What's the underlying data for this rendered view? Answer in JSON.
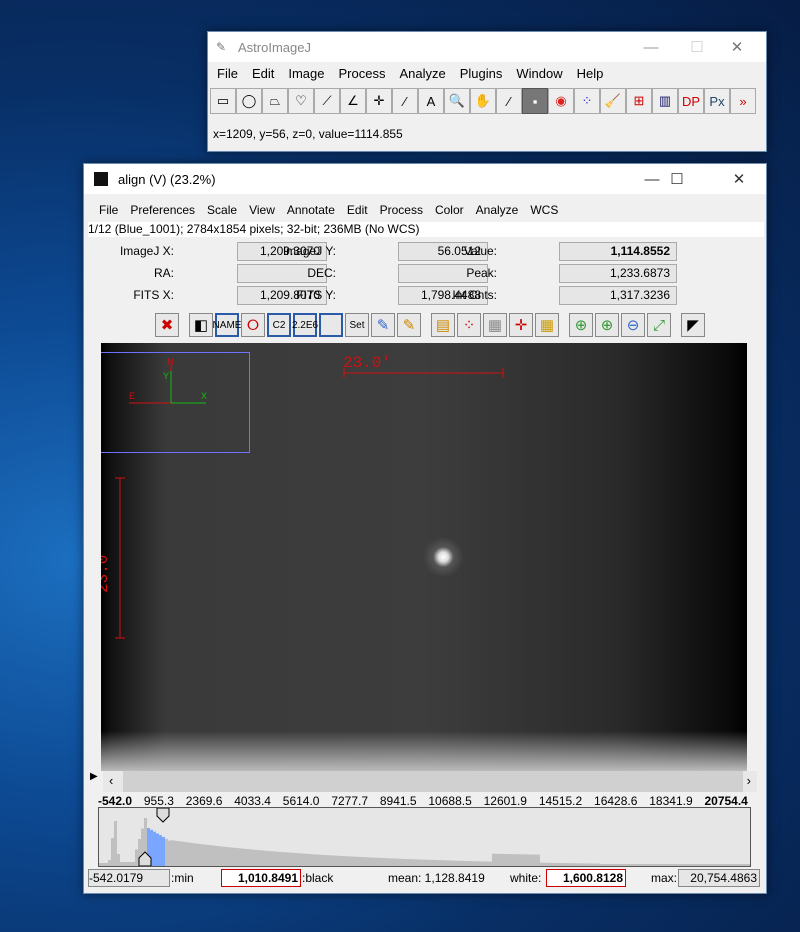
{
  "main_window": {
    "title": "AstroImageJ",
    "controls": {
      "minimize": "—",
      "maximize": "☐",
      "close": "✕"
    },
    "menu": [
      "File",
      "Edit",
      "Image",
      "Process",
      "Analyze",
      "Plugins",
      "Window",
      "Help"
    ],
    "tools": [
      {
        "icon": "rectangle-icon",
        "glyph": "▭"
      },
      {
        "icon": "oval-icon",
        "glyph": "◯"
      },
      {
        "icon": "polygon-icon",
        "glyph": "⏢"
      },
      {
        "icon": "freehand-icon",
        "glyph": "♡"
      },
      {
        "icon": "line-icon",
        "glyph": "⟋"
      },
      {
        "icon": "angle-icon",
        "glyph": "∠"
      },
      {
        "icon": "point-icon",
        "glyph": "✛"
      },
      {
        "icon": "wand-icon",
        "glyph": "⁄"
      },
      {
        "icon": "text-icon",
        "glyph": "A"
      },
      {
        "icon": "magnifier-icon",
        "glyph": "🔍"
      },
      {
        "icon": "hand-icon",
        "glyph": "✋"
      },
      {
        "icon": "dropper-icon",
        "glyph": "⁄"
      },
      {
        "icon": "astro-image-icon",
        "glyph": "▪"
      },
      {
        "icon": "aperture-icon",
        "glyph": "◉"
      },
      {
        "icon": "multi-aperture-icon",
        "glyph": "⁘"
      },
      {
        "icon": "broom-icon",
        "glyph": "🧹"
      },
      {
        "icon": "plot-icon",
        "glyph": "⊞"
      },
      {
        "icon": "table-icon",
        "glyph": "▥"
      },
      {
        "icon": "dp-icon",
        "glyph": "DP"
      },
      {
        "icon": "fits-header-icon",
        "glyph": "Px"
      },
      {
        "icon": "more-icon",
        "glyph": "»"
      }
    ],
    "status": "x=1209, y=56, z=0, value=1114.855"
  },
  "image_window": {
    "title": "align (V) (23.2%)",
    "menu": [
      "File",
      "Preferences",
      "Scale",
      "View",
      "Annotate",
      "Edit",
      "Process",
      "Color",
      "Analyze",
      "WCS"
    ],
    "info": "1/12 (Blue_1001); 2784x1854 pixels; 32-bit; 236MB (No WCS)",
    "fields": {
      "imagej_x": {
        "label": "ImageJ X:",
        "value": "1,209.3070"
      },
      "imagej_y": {
        "label": "ImageJ Y:",
        "value": "56.0512"
      },
      "value": {
        "label": "Value:",
        "value": "1,114.8552"
      },
      "ra": {
        "label": "RA:",
        "value": ""
      },
      "dec": {
        "label": "DEC:",
        "value": ""
      },
      "peak": {
        "label": "Peak:",
        "value": "1,233.6873"
      },
      "fits_x": {
        "label": "FITS X:",
        "value": "1,209.8070"
      },
      "fits_y": {
        "label": "FITS Y:",
        "value": "1,798.4488"
      },
      "int_cnts": {
        "label": "Int Cnts:",
        "value": "1,317.3236"
      }
    },
    "icon_buttons": [
      "",
      "",
      "NAME",
      "",
      "C2",
      "2.2E6",
      "",
      "Set",
      "",
      "",
      "",
      "",
      "",
      "",
      "",
      "",
      "",
      "",
      "",
      ""
    ],
    "scale_label_x": "23.0'",
    "scale_label_y": "23.0'",
    "compass": {
      "north": "N",
      "east": "E",
      "x": "X",
      "y": "Y"
    },
    "hist_ticks": [
      "-542.0",
      "955.3",
      "2369.6",
      "4033.4",
      "5614.0",
      "7277.7",
      "8941.5",
      "10688.5",
      "12601.9",
      "14515.2",
      "16428.6",
      "18341.9",
      "20754.4"
    ],
    "min": {
      "value": "-542.0179",
      "label": ":min"
    },
    "black": {
      "value": "1,010.8491",
      "label": ":black"
    },
    "mean": "mean: 1,128.8419",
    "white": {
      "label": "white:",
      "value": "1,600.8128"
    },
    "max": {
      "label": "max:",
      "value": "20,754.4863"
    },
    "colors": {
      "scale_bar": "#d01010",
      "overlay_box": "#7070ff",
      "hist_fill": "#c0c0c0",
      "hist_selected": "#7aa6ff"
    }
  }
}
